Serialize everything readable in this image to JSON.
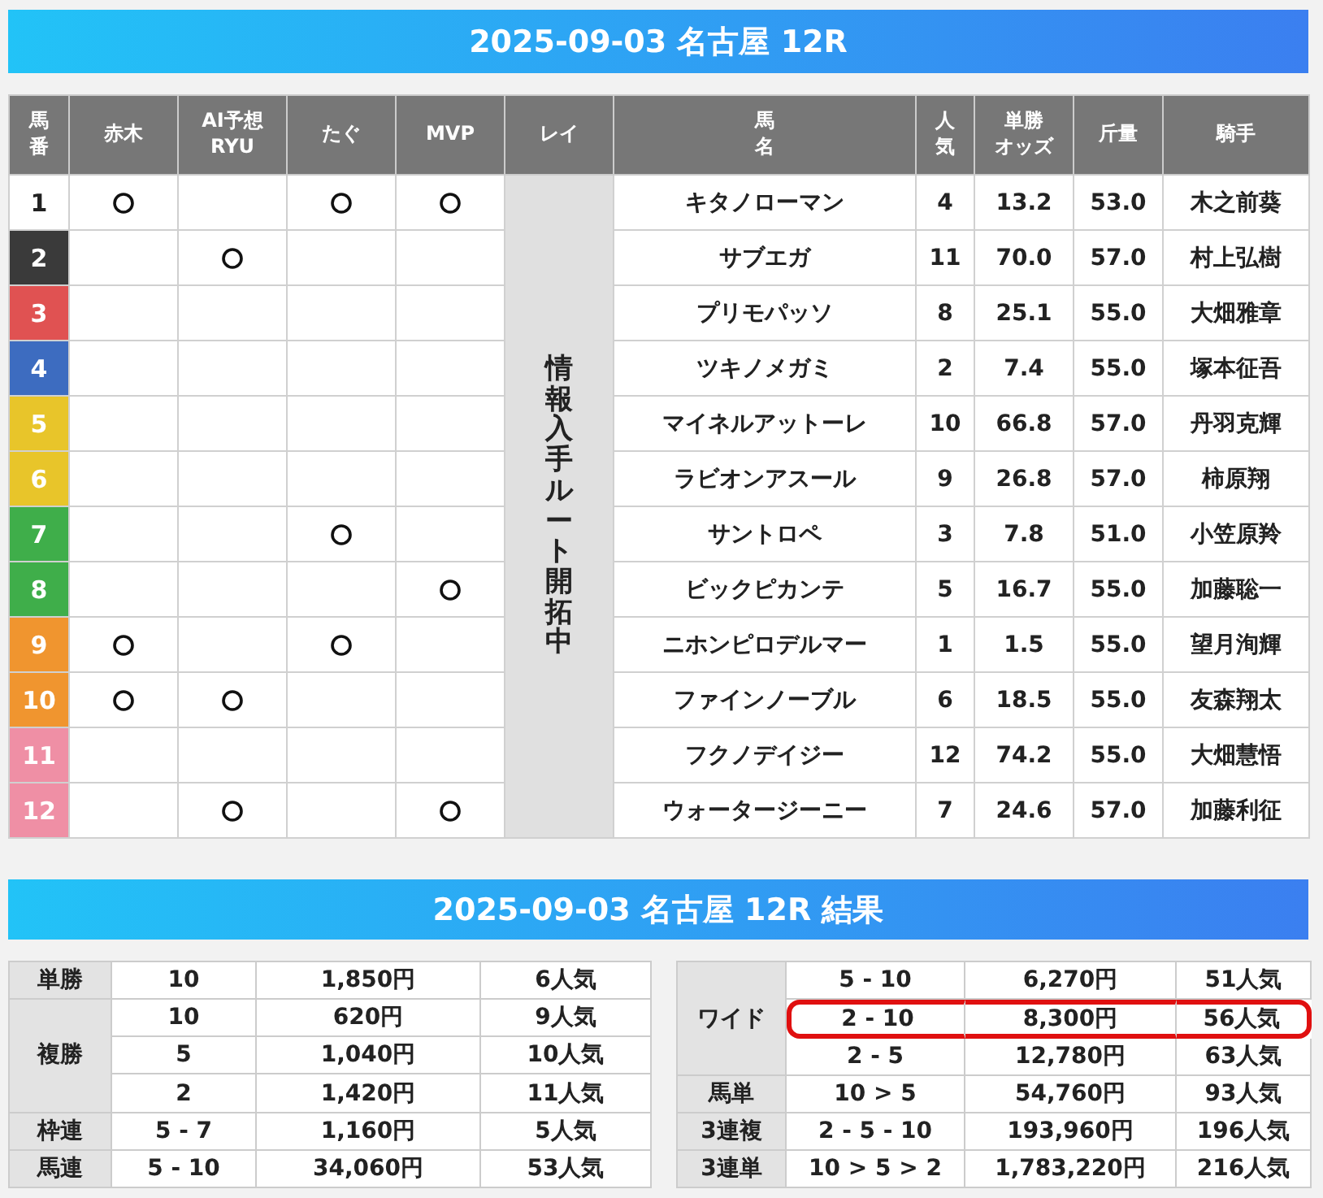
{
  "race_title": "2025-09-03 名古屋 12R",
  "columns": [
    {
      "lines": [
        "馬",
        "番"
      ]
    },
    {
      "lines": [
        "赤木"
      ]
    },
    {
      "lines": [
        "AI予想",
        "RYU"
      ]
    },
    {
      "lines": [
        "たぐ"
      ]
    },
    {
      "lines": [
        "MVP"
      ]
    },
    {
      "lines": [
        "レイ"
      ]
    },
    {
      "lines": [
        "馬",
        "名"
      ]
    },
    {
      "lines": [
        "人",
        "気"
      ]
    },
    {
      "lines": [
        "単勝",
        "オッズ"
      ]
    },
    {
      "lines": [
        "斤量"
      ]
    },
    {
      "lines": [
        "騎手"
      ]
    }
  ],
  "rei_note": "情報入手ルート開拓中",
  "rows": [
    {
      "number": "1",
      "color": "#ffffff",
      "picks": [
        true,
        false,
        true,
        true
      ],
      "horse": "キタノローマン",
      "popularity": "4",
      "odds": "13.2",
      "weight": "53.0",
      "jockey": "木之前葵"
    },
    {
      "number": "2",
      "color": "#3a3a3a",
      "picks": [
        false,
        true,
        false,
        false
      ],
      "horse": "サブエガ",
      "popularity": "11",
      "odds": "70.0",
      "weight": "57.0",
      "jockey": "村上弘樹"
    },
    {
      "number": "3",
      "color": "#e05252",
      "picks": [
        false,
        false,
        false,
        false
      ],
      "horse": "プリモパッソ",
      "popularity": "8",
      "odds": "25.1",
      "weight": "55.0",
      "jockey": "大畑雅章"
    },
    {
      "number": "4",
      "color": "#3d6cc0",
      "picks": [
        false,
        false,
        false,
        false
      ],
      "horse": "ツキノメガミ",
      "popularity": "2",
      "odds": "7.4",
      "weight": "55.0",
      "jockey": "塚本征吾"
    },
    {
      "number": "5",
      "color": "#e8c52a",
      "picks": [
        false,
        false,
        false,
        false
      ],
      "horse": "マイネルアットーレ",
      "popularity": "10",
      "odds": "66.8",
      "weight": "57.0",
      "jockey": "丹羽克輝"
    },
    {
      "number": "6",
      "color": "#e8c52a",
      "picks": [
        false,
        false,
        false,
        false
      ],
      "horse": "ラビオンアスール",
      "popularity": "9",
      "odds": "26.8",
      "weight": "57.0",
      "jockey": "柿原翔"
    },
    {
      "number": "7",
      "color": "#3fae4a",
      "picks": [
        false,
        false,
        true,
        false
      ],
      "horse": "サントロペ",
      "popularity": "3",
      "odds": "7.8",
      "weight": "51.0",
      "jockey": "小笠原羚"
    },
    {
      "number": "8",
      "color": "#3fae4a",
      "picks": [
        false,
        false,
        false,
        true
      ],
      "horse": "ビックピカンテ",
      "popularity": "5",
      "odds": "16.7",
      "weight": "55.0",
      "jockey": "加藤聡一"
    },
    {
      "number": "9",
      "color": "#f0952f",
      "picks": [
        true,
        false,
        true,
        false
      ],
      "horse": "ニホンピロデルマー",
      "popularity": "1",
      "odds": "1.5",
      "weight": "55.0",
      "jockey": "望月洵輝"
    },
    {
      "number": "10",
      "color": "#f0952f",
      "picks": [
        true,
        true,
        false,
        false
      ],
      "horse": "ファインノーブル",
      "popularity": "6",
      "odds": "18.5",
      "weight": "55.0",
      "jockey": "友森翔太"
    },
    {
      "number": "11",
      "color": "#ef8fa5",
      "picks": [
        false,
        false,
        false,
        false
      ],
      "horse": "フクノデイジー",
      "popularity": "12",
      "odds": "74.2",
      "weight": "55.0",
      "jockey": "大畑慧悟"
    },
    {
      "number": "12",
      "color": "#ef8fa5",
      "picks": [
        false,
        true,
        false,
        true
      ],
      "horse": "ウォータージーニー",
      "popularity": "7",
      "odds": "24.6",
      "weight": "57.0",
      "jockey": "加藤利征"
    }
  ],
  "result_title": "2025-09-03 名古屋 12R 結果",
  "results_left": [
    {
      "bet": "単勝",
      "entries": [
        {
          "combo": "10",
          "payout": "1,850円",
          "popularity": "6人気",
          "highlighted": false
        }
      ]
    },
    {
      "bet": "複勝",
      "entries": [
        {
          "combo": "10",
          "payout": "620円",
          "popularity": "9人気",
          "highlighted": false
        },
        {
          "combo": "5",
          "payout": "1,040円",
          "popularity": "10人気",
          "highlighted": false
        },
        {
          "combo": "2",
          "payout": "1,420円",
          "popularity": "11人気",
          "highlighted": false
        }
      ]
    },
    {
      "bet": "枠連",
      "entries": [
        {
          "combo": "5 - 7",
          "payout": "1,160円",
          "popularity": "5人気",
          "highlighted": false
        }
      ]
    },
    {
      "bet": "馬連",
      "entries": [
        {
          "combo": "5 - 10",
          "payout": "34,060円",
          "popularity": "53人気",
          "highlighted": false
        }
      ]
    }
  ],
  "results_right": [
    {
      "bet": "ワイド",
      "entries": [
        {
          "combo": "5 - 10",
          "payout": "6,270円",
          "popularity": "51人気",
          "highlighted": false
        },
        {
          "combo": "2 - 10",
          "payout": "8,300円",
          "popularity": "56人気",
          "highlighted": true
        },
        {
          "combo": "2 - 5",
          "payout": "12,780円",
          "popularity": "63人気",
          "highlighted": false
        }
      ]
    },
    {
      "bet": "馬単",
      "entries": [
        {
          "combo": "10 > 5",
          "payout": "54,760円",
          "popularity": "93人気",
          "highlighted": false
        }
      ]
    },
    {
      "bet": "3連複",
      "entries": [
        {
          "combo": "2 - 5 - 10",
          "payout": "193,960円",
          "popularity": "196人気",
          "highlighted": false
        }
      ]
    },
    {
      "bet": "3連単",
      "entries": [
        {
          "combo": "10 > 5 > 2",
          "payout": "1,783,220円",
          "popularity": "216人気",
          "highlighted": false
        }
      ]
    }
  ]
}
